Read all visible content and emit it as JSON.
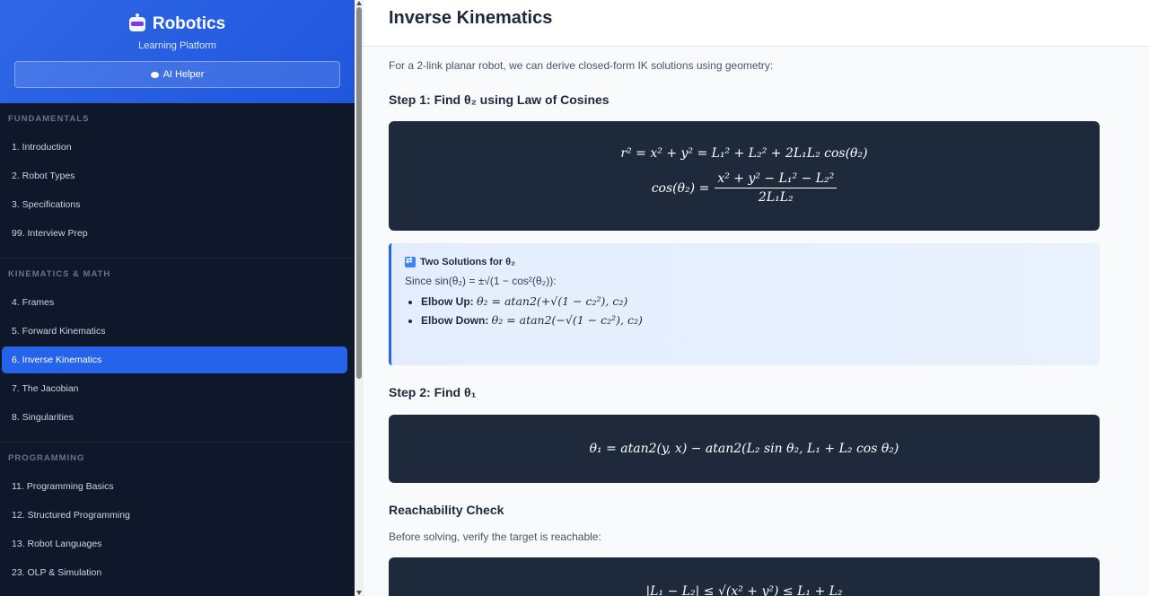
{
  "sidebar": {
    "brand": "Robotics",
    "subtitle": "Learning Platform",
    "ai_button": "AI Helper",
    "sections": [
      {
        "title": "FUNDAMENTALS",
        "items": [
          "1. Introduction",
          "2. Robot Types",
          "3. Specifications",
          "99. Interview Prep"
        ]
      },
      {
        "title": "KINEMATICS & MATH",
        "items": [
          "4. Frames",
          "5. Forward Kinematics",
          "6. Inverse Kinematics",
          "7. The Jacobian",
          "8. Singularities"
        ]
      },
      {
        "title": "PROGRAMMING",
        "items": [
          "11. Programming Basics",
          "12. Structured Programming",
          "13. Robot Languages",
          "23. OLP & Simulation"
        ]
      }
    ],
    "active_item": "6. Inverse Kinematics"
  },
  "main": {
    "title": "Inverse Kinematics",
    "intro": "For a 2-link planar robot, we can derive closed-form IK solutions using geometry:",
    "step1_heading": "Step 1: Find θ₂ using Law of Cosines",
    "step1_eq1": "r² = x² + y² = L₁² + L₂² + 2L₁L₂ cos(θ₂)",
    "step1_eq2_lhs": "cos(θ₂) =",
    "step1_eq2_num": "x² + y² − L₁² − L₂²",
    "step1_eq2_den": "2L₁L₂",
    "callout": {
      "title": "Two Solutions for θ₂",
      "since": "Since sin(θ₂) = ±√(1 − cos²(θ₂)):",
      "items": [
        {
          "label": "Elbow Up:",
          "formula": "θ₂ = atan2(+√(1 − c₂²), c₂)"
        },
        {
          "label": "Elbow Down:",
          "formula": "θ₂ = atan2(−√(1 − c₂²), c₂)"
        }
      ]
    },
    "step2_heading": "Step 2: Find θ₁",
    "step2_eq": "θ₁ = atan2(y, x) − atan2(L₂ sin θ₂, L₁ + L₂ cos θ₂)",
    "reach_heading": "Reachability Check",
    "reach_text": "Before solving, verify the target is reachable:",
    "reach_eq": "|L₁ − L₂| ≤ √(x² + y²) ≤ L₁ + L₂"
  }
}
